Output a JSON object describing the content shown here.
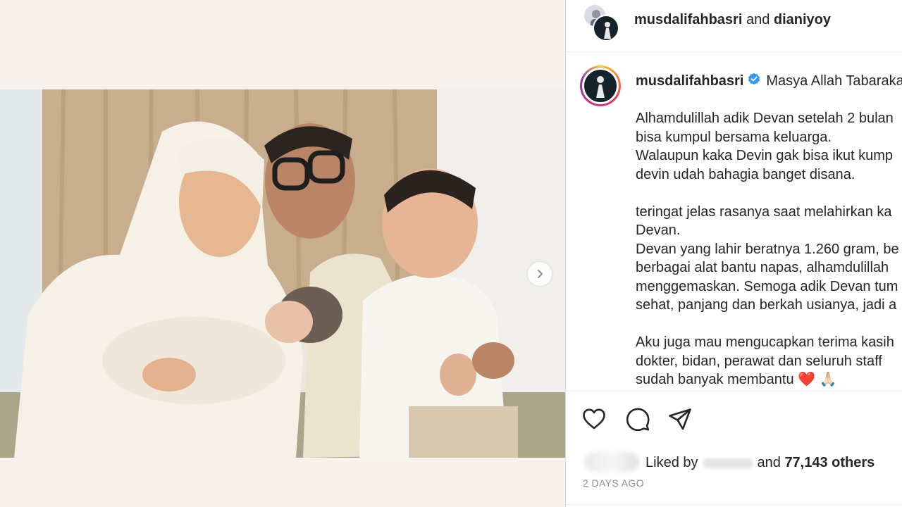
{
  "header": {
    "user1": "musdalifahbasri",
    "connector": "and",
    "user2": "dianiyoy"
  },
  "caption": {
    "username": "musdalifahbasri",
    "first_line": "Masya Allah Tabaraka",
    "body": "Alhamdulillah adik Devan setelah 2 bulan\nbisa kumpul bersama keluarga.\nWalaupun kaka Devin gak bisa ikut kump\ndevin udah bahagia banget disana.\n\nteringat jelas rasanya saat melahirkan ka\nDevan.\nDevan yang lahir beratnya 1.260 gram, be\nberbagai alat bantu napas, alhamdulillah\nmenggemaskan. Semoga adik Devan tum\nsehat, panjang dan berkah usianya, jadi a\n\nAku juga mau mengucapkan terima kasih\ndokter, bidan, perawat dan seluruh staff \nsudah banyak membantu ❤️ 🙏🏻"
  },
  "likes": {
    "prefix": "Liked by",
    "middle": "and",
    "count": "77,143 others"
  },
  "timestamp": "2 DAYS AGO",
  "icons": [
    "heart-icon",
    "comment-icon",
    "share-icon",
    "verified-badge-icon",
    "chevron-right-icon"
  ],
  "colors": {
    "verified": "#3897f0",
    "text": "#262626",
    "muted": "#8e8e8e"
  }
}
